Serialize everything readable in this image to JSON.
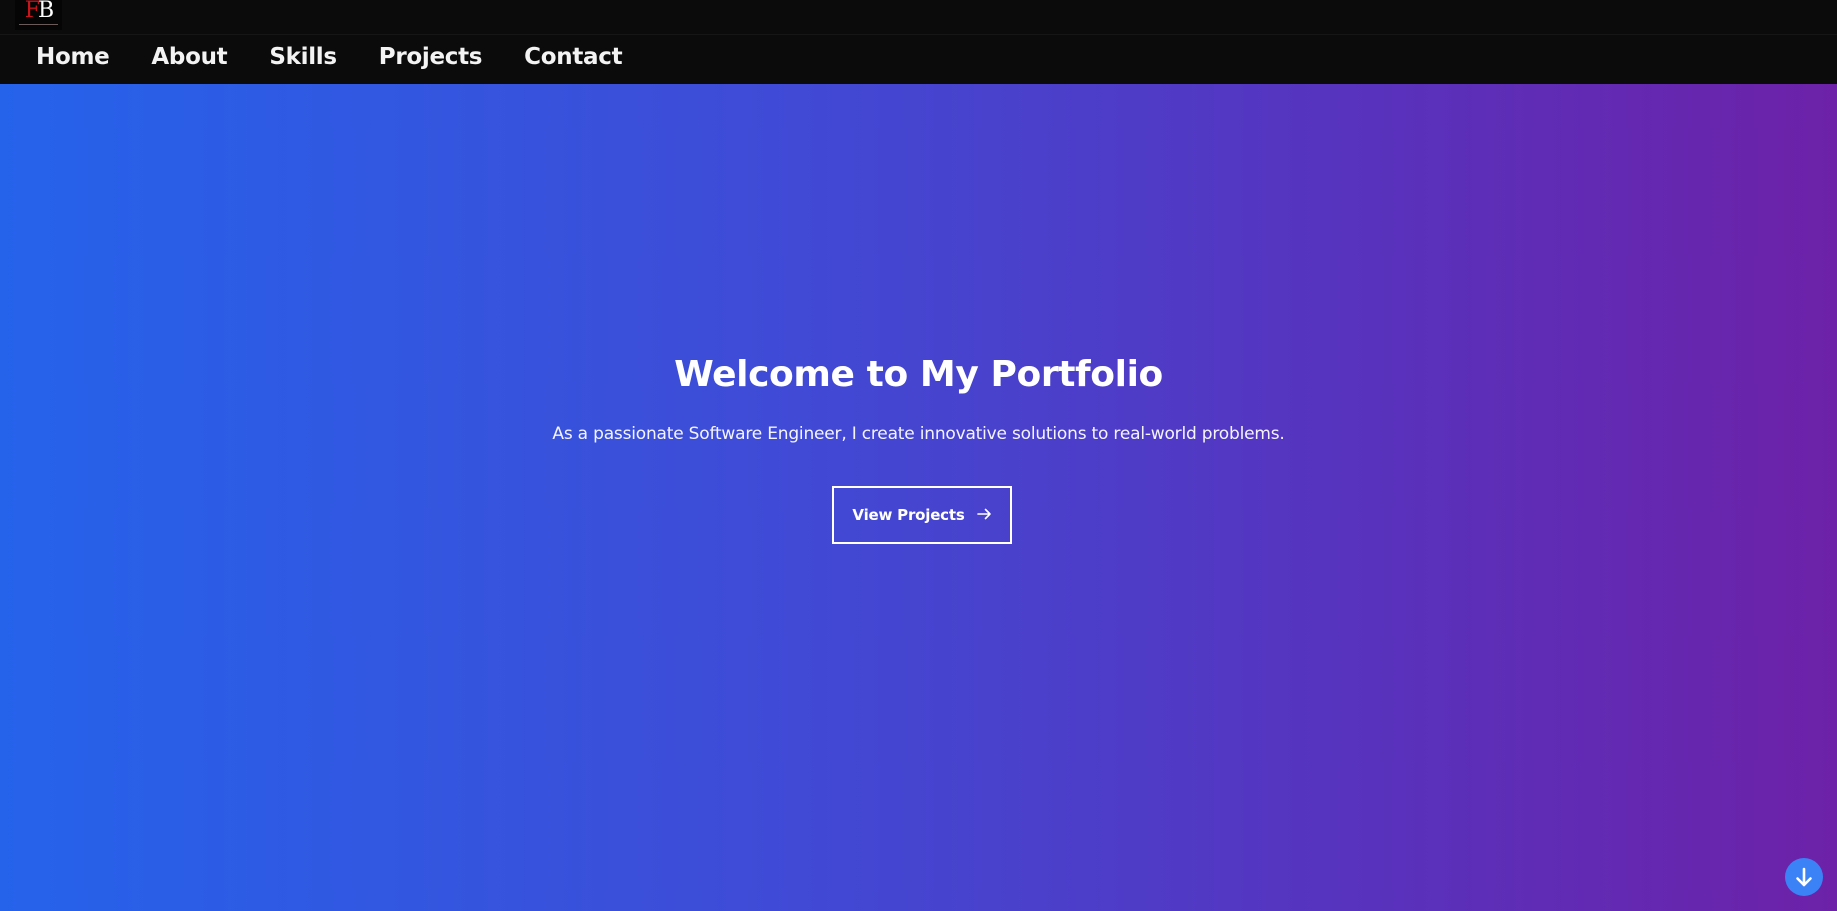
{
  "header": {
    "logo": {
      "text_left": "F",
      "text_right": "B"
    },
    "nav": [
      {
        "label": "Home"
      },
      {
        "label": "About"
      },
      {
        "label": "Skills"
      },
      {
        "label": "Projects"
      },
      {
        "label": "Contact"
      }
    ]
  },
  "hero": {
    "title": "Welcome to My Portfolio",
    "subtitle": "As a passionate Software Engineer, I create innovative solutions to real-world problems.",
    "cta": {
      "label": "View Projects",
      "icon": "arrow-right-icon"
    }
  },
  "scroll_button": {
    "icon": "arrow-down-icon"
  },
  "colors": {
    "nav_background": "#0b0b0b",
    "gradient_start": "#2563eb",
    "gradient_end": "#6d21a8",
    "scroll_button": "#3b82f6",
    "logo_accent": "#c8141b"
  }
}
